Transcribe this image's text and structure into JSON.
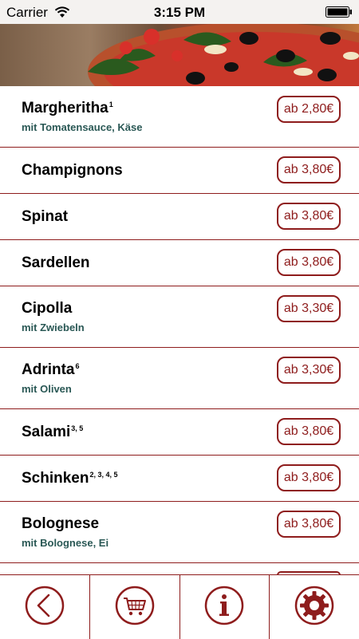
{
  "status_bar": {
    "carrier": "Carrier",
    "time": "3:15 PM"
  },
  "colors": {
    "accent": "#8e1c1c",
    "description": "#2a5855"
  },
  "menu": {
    "items": [
      {
        "name": "Margheritha",
        "sup": "1",
        "desc": "mit Tomatensauce, Käse",
        "price": "ab 2,80€"
      },
      {
        "name": "Champignons",
        "sup": "",
        "desc": "",
        "price": "ab 3,80€"
      },
      {
        "name": "Spinat",
        "sup": "",
        "desc": "",
        "price": "ab 3,80€"
      },
      {
        "name": "Sardellen",
        "sup": "",
        "desc": "",
        "price": "ab 3,80€"
      },
      {
        "name": "Cipolla",
        "sup": "",
        "desc": "mit Zwiebeln",
        "price": "ab 3,30€"
      },
      {
        "name": "Adrinta",
        "sup": "6",
        "desc": "mit Oliven",
        "price": "ab 3,30€"
      },
      {
        "name": "Salami",
        "sup": "3, 5",
        "desc": "",
        "price": "ab 3,80€"
      },
      {
        "name": "Schinken",
        "sup": "2, 3, 4, 5",
        "desc": "",
        "price": "ab 3,80€"
      },
      {
        "name": "Bolognese",
        "sup": "",
        "desc": "mit Bolognese, Ei",
        "price": "ab 3,80€"
      }
    ]
  },
  "tab_bar": {
    "tabs": [
      {
        "icon": "back-icon"
      },
      {
        "icon": "cart-icon"
      },
      {
        "icon": "info-icon"
      },
      {
        "icon": "settings-gear-icon"
      }
    ]
  }
}
